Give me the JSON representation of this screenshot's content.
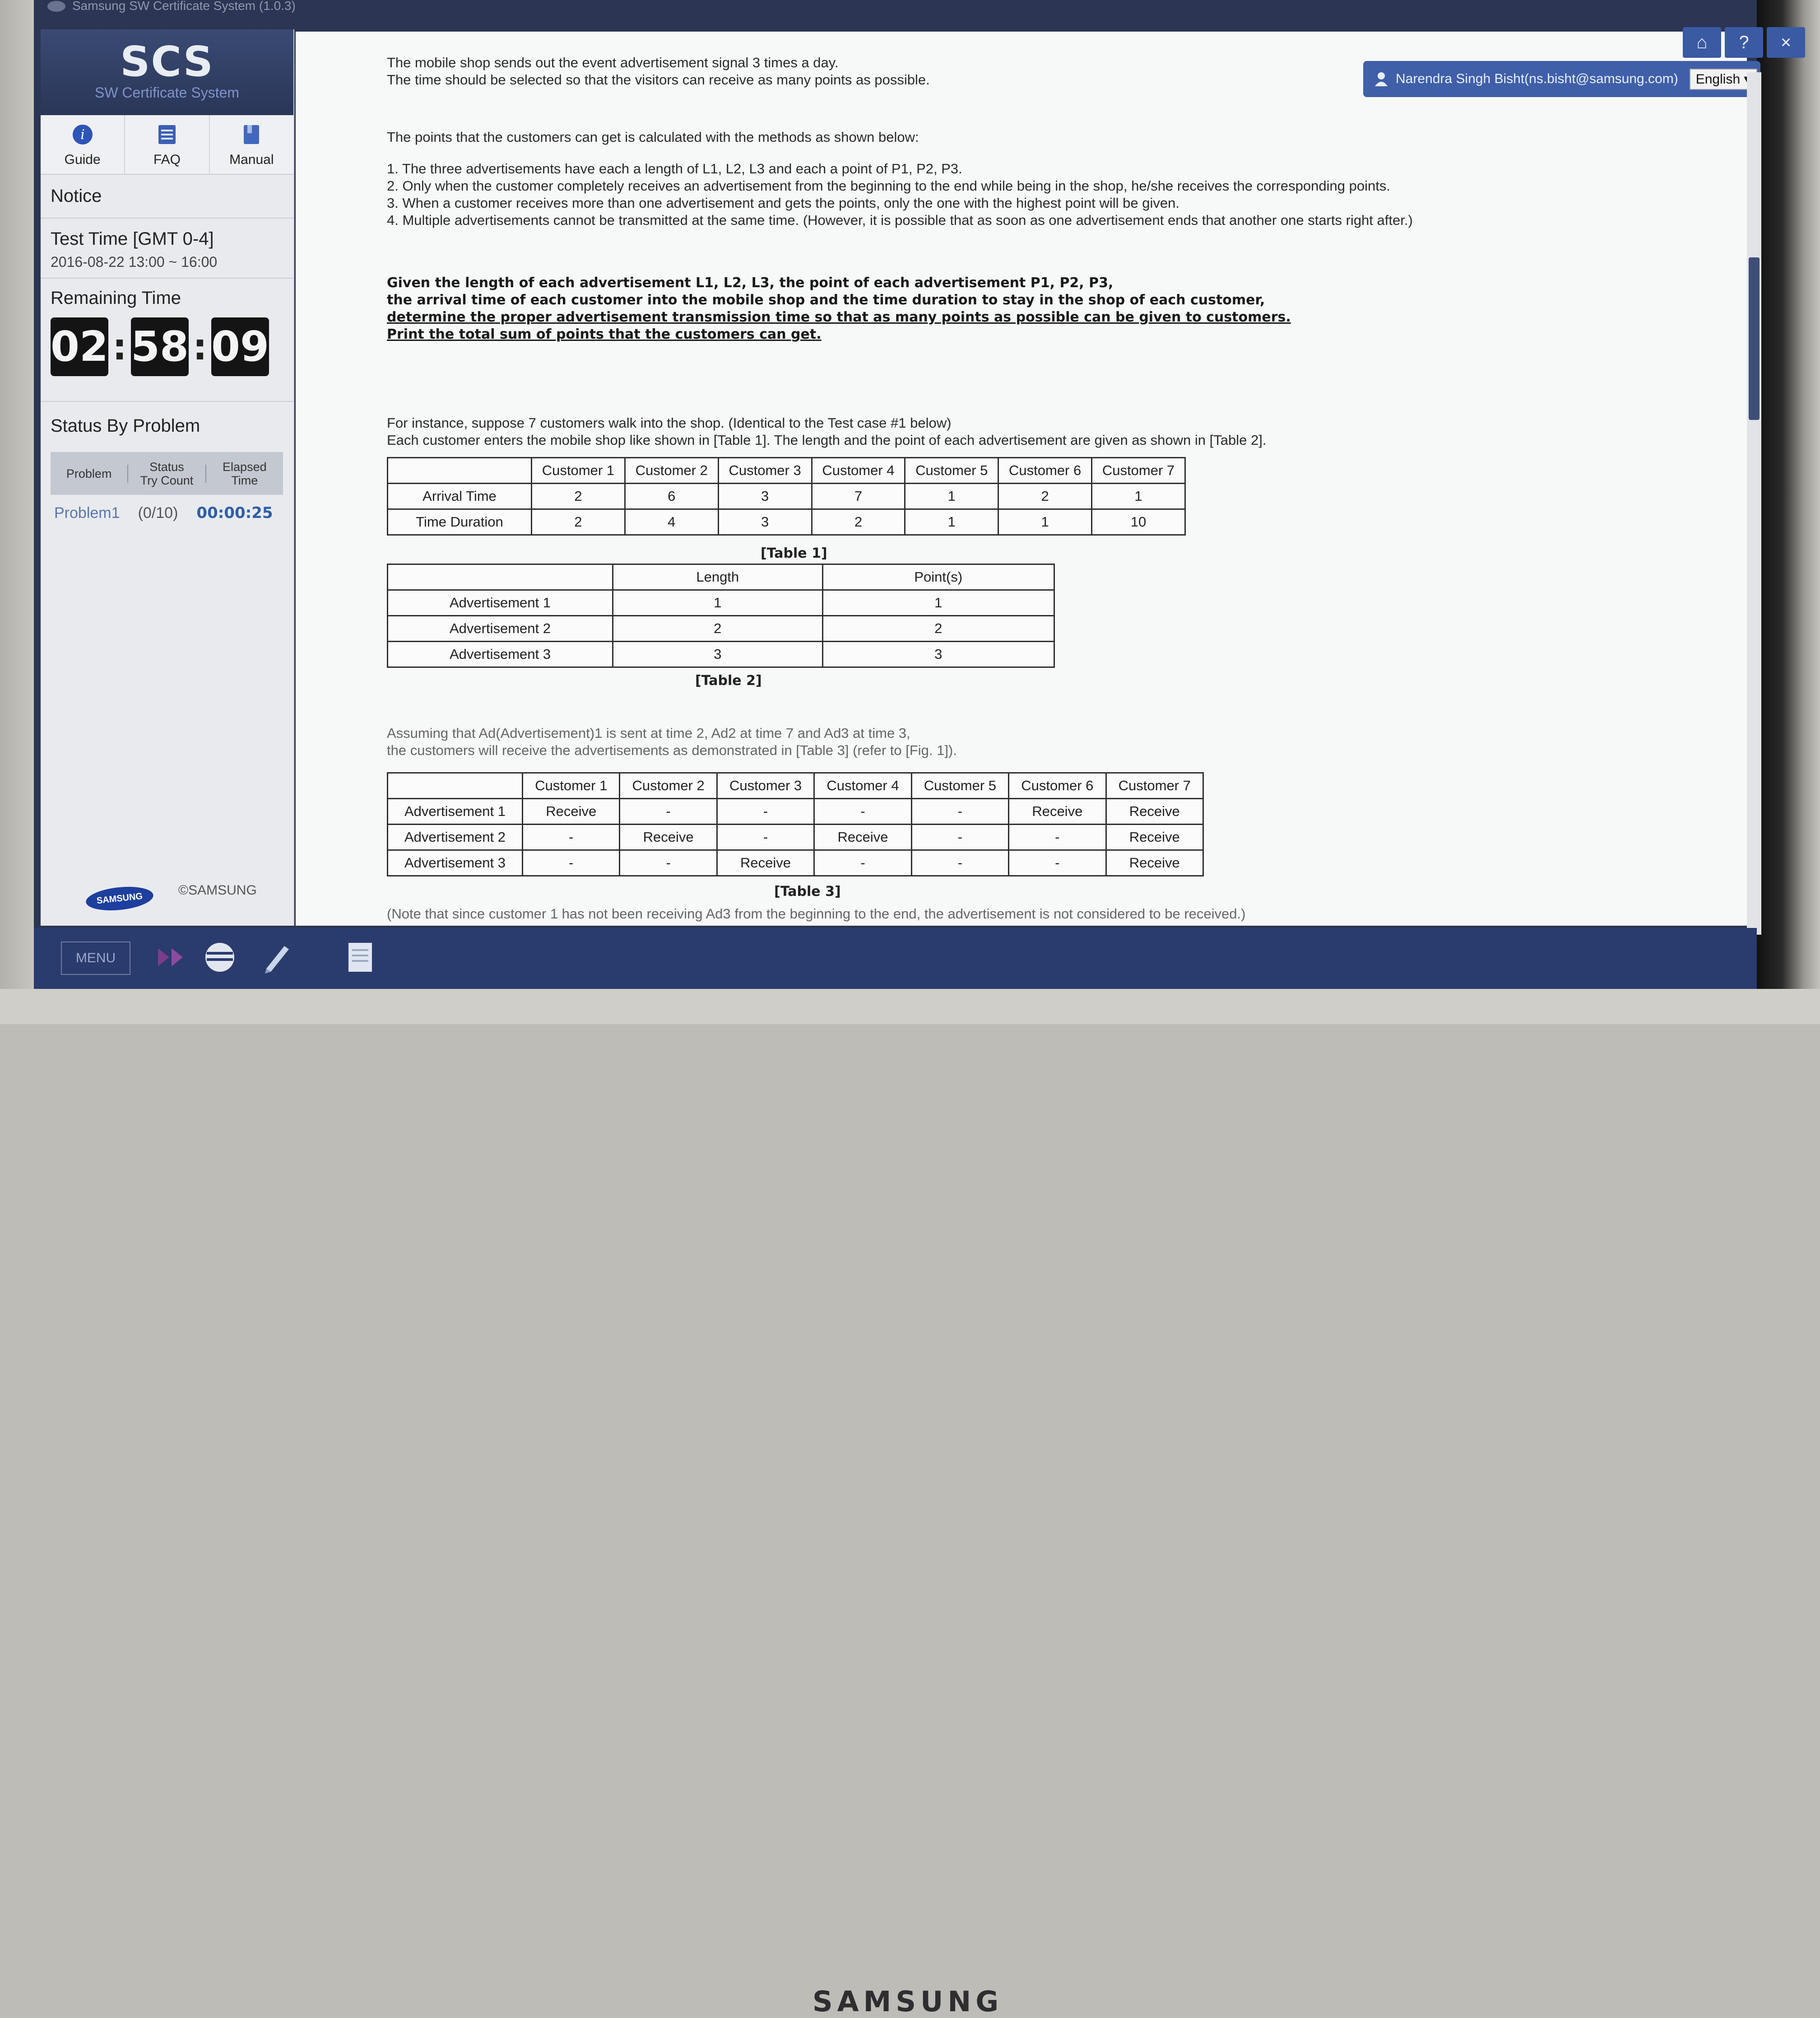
{
  "window": {
    "title": "Samsung SW Certificate System (1.0.3)"
  },
  "brand": {
    "label": "SAMSUNG"
  },
  "sidebar": {
    "logo": "SCS",
    "subtitle": "SW Certificate System",
    "nav": [
      {
        "label": "Guide",
        "icon": "info-icon"
      },
      {
        "label": "FAQ",
        "icon": "faq-icon"
      },
      {
        "label": "Manual",
        "icon": "manual-icon"
      }
    ],
    "notice_label": "Notice",
    "test_time_label": "Test Time [GMT 0-4]",
    "test_time_value": "2016-08-22 13:00 ~ 16:00",
    "remaining_label": "Remaining Time",
    "remaining": {
      "hh": "02",
      "mm": "58",
      "ss": "09"
    },
    "status_label": "Status By Problem",
    "status_headers": {
      "problem": "Problem",
      "status": "Status",
      "try_count": "Try Count",
      "elapsed": "Elapsed",
      "time": "Time"
    },
    "status_row": {
      "problem": "Problem1",
      "count": "(0/10)",
      "elapsed": "00:00:25"
    },
    "footer_logo": "SAMSUNG",
    "footer_copy": "©SAMSUNG"
  },
  "header": {
    "user": "Narendra Singh Bisht(ns.bisht@samsung.com)",
    "language": "English",
    "buttons": {
      "home": "⌂",
      "help": "?",
      "close": "×"
    }
  },
  "content": {
    "intro": [
      "The mobile shop sends out the event advertisement signal 3 times a day.",
      "The time should be selected so that the visitors can receive as many points as possible."
    ],
    "points_intro": "The points that the customers can get is calculated with the methods as shown below:",
    "rules": [
      "1. The three advertisements have each a length of L1, L2, L3 and each a point of P1, P2, P3.",
      "2. Only when the customer completely receives an advertisement from the beginning to the end while being in the shop, he/she receives the corresponding points.",
      "3. When a customer receives more than one advertisement and gets the points, only the one with the highest point will be given.",
      "4. Multiple advertisements cannot be transmitted at the same time. (However, it is possible that as soon as one advertisement ends that another one starts right after.)"
    ],
    "task": [
      "Given the length of each advertisement L1, L2, L3, the point of each advertisement P1, P2, P3,",
      "the arrival time of each customer into the mobile shop and the time duration to stay in the shop of each customer,",
      "determine the proper advertisement transmission time so that as many points as possible can be given to customers.",
      "Print the total sum of points that the customers can get."
    ],
    "example": [
      "For instance, suppose 7 customers walk into the shop. (Identical to the Test case #1 below)",
      "Each customer enters the mobile shop like shown in [Table 1]. The length and the point of each advertisement are given as shown in [Table 2]."
    ],
    "table1": {
      "headers": [
        "",
        "Customer 1",
        "Customer 2",
        "Customer 3",
        "Customer 4",
        "Customer 5",
        "Customer 6",
        "Customer 7"
      ],
      "rows": [
        [
          "Arrival Time",
          "2",
          "6",
          "3",
          "7",
          "1",
          "2",
          "1"
        ],
        [
          "Time Duration",
          "2",
          "4",
          "3",
          "2",
          "1",
          "1",
          "10"
        ]
      ],
      "caption": "[Table 1]"
    },
    "table2": {
      "headers": [
        "",
        "Length",
        "Point(s)"
      ],
      "rows": [
        [
          "Advertisement 1",
          "1",
          "1"
        ],
        [
          "Advertisement 2",
          "2",
          "2"
        ],
        [
          "Advertisement 3",
          "3",
          "3"
        ]
      ],
      "caption": "[Table 2]"
    },
    "assumption": [
      "Assuming that Ad(Advertisement)1 is sent at time 2, Ad2 at time 7 and Ad3 at time 3,",
      "the customers will receive the advertisements as demonstrated in [Table 3] (refer to [Fig. 1])."
    ],
    "table3": {
      "headers": [
        "",
        "Customer 1",
        "Customer 2",
        "Customer 3",
        "Customer 4",
        "Customer 5",
        "Customer 6",
        "Customer 7"
      ],
      "rows": [
        [
          "Advertisement 1",
          "Receive",
          "-",
          "-",
          "-",
          "-",
          "Receive",
          "Receive"
        ],
        [
          "Advertisement 2",
          "-",
          "Receive",
          "-",
          "Receive",
          "-",
          "-",
          "Receive"
        ],
        [
          "Advertisement 3",
          "-",
          "-",
          "Receive",
          "-",
          "-",
          "-",
          "Receive"
        ]
      ],
      "caption": "[Table 3]"
    },
    "note": "(Note that since customer 1 has not been receiving Ad3 from the beginning to the end, the advertisement is not considered to be received.)"
  },
  "taskbar": {
    "menu": "MENU",
    "icons": [
      "media-icon",
      "network-icon",
      "pen-icon",
      "document-icon"
    ]
  },
  "colors": {
    "sidebar_head": "#2a3658",
    "accent": "#3f5fa8",
    "taskbar": "#2a3b6e"
  }
}
